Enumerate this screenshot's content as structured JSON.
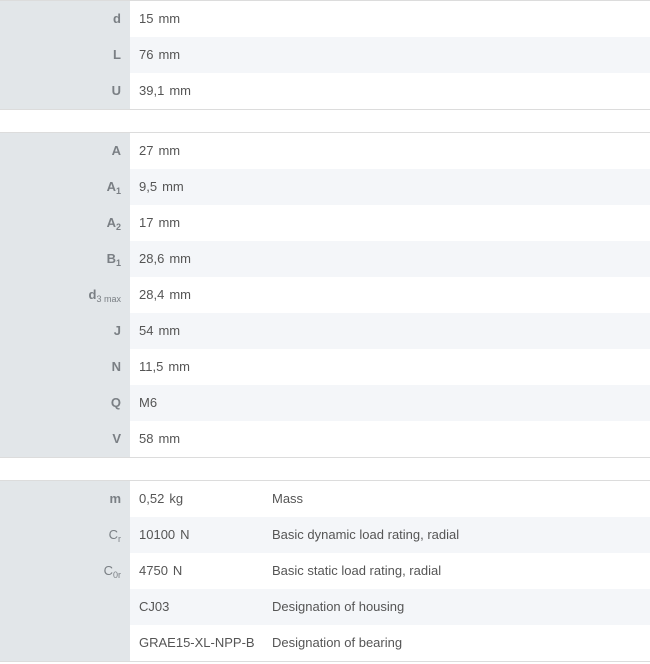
{
  "dimensions_group": [
    {
      "symbol": "d",
      "sub": "",
      "value": "15",
      "unit": "mm"
    },
    {
      "symbol": "L",
      "sub": "",
      "value": "76",
      "unit": "mm"
    },
    {
      "symbol": "U",
      "sub": "",
      "value": "39,1",
      "unit": "mm"
    }
  ],
  "mounting_group": [
    {
      "symbol": "A",
      "sub": "",
      "value": "27",
      "unit": "mm"
    },
    {
      "symbol": "A",
      "sub": "1",
      "value": "9,5",
      "unit": "mm"
    },
    {
      "symbol": "A",
      "sub": "2",
      "value": "17",
      "unit": "mm"
    },
    {
      "symbol": "B",
      "sub": "1",
      "value": "28,6",
      "unit": "mm"
    },
    {
      "symbol": "d",
      "sub": "3 max",
      "value": "28,4",
      "unit": "mm"
    },
    {
      "symbol": "J",
      "sub": "",
      "value": "54",
      "unit": "mm"
    },
    {
      "symbol": "N",
      "sub": "",
      "value": "11,5",
      "unit": "mm"
    },
    {
      "symbol": "Q",
      "sub": "",
      "value": "M6",
      "unit": ""
    },
    {
      "symbol": "V",
      "sub": "",
      "value": "58",
      "unit": "mm"
    }
  ],
  "ratings_group": [
    {
      "symbol": "m",
      "sub": "",
      "value": "0,52",
      "unit": "kg",
      "description": "Mass"
    },
    {
      "symbol": "C",
      "sub": "r",
      "value": "10100",
      "unit": "N",
      "description": "Basic dynamic load rating, radial"
    },
    {
      "symbol": "C",
      "sub": "0r",
      "value": "4750",
      "unit": "N",
      "description": "Basic static load rating, radial"
    },
    {
      "symbol": "",
      "sub": "",
      "value": "CJ03",
      "unit": "",
      "description": "Designation of housing"
    },
    {
      "symbol": "",
      "sub": "",
      "value": "GRAE15-XL-NPP-B",
      "unit": "",
      "description": "Designation of bearing"
    }
  ]
}
